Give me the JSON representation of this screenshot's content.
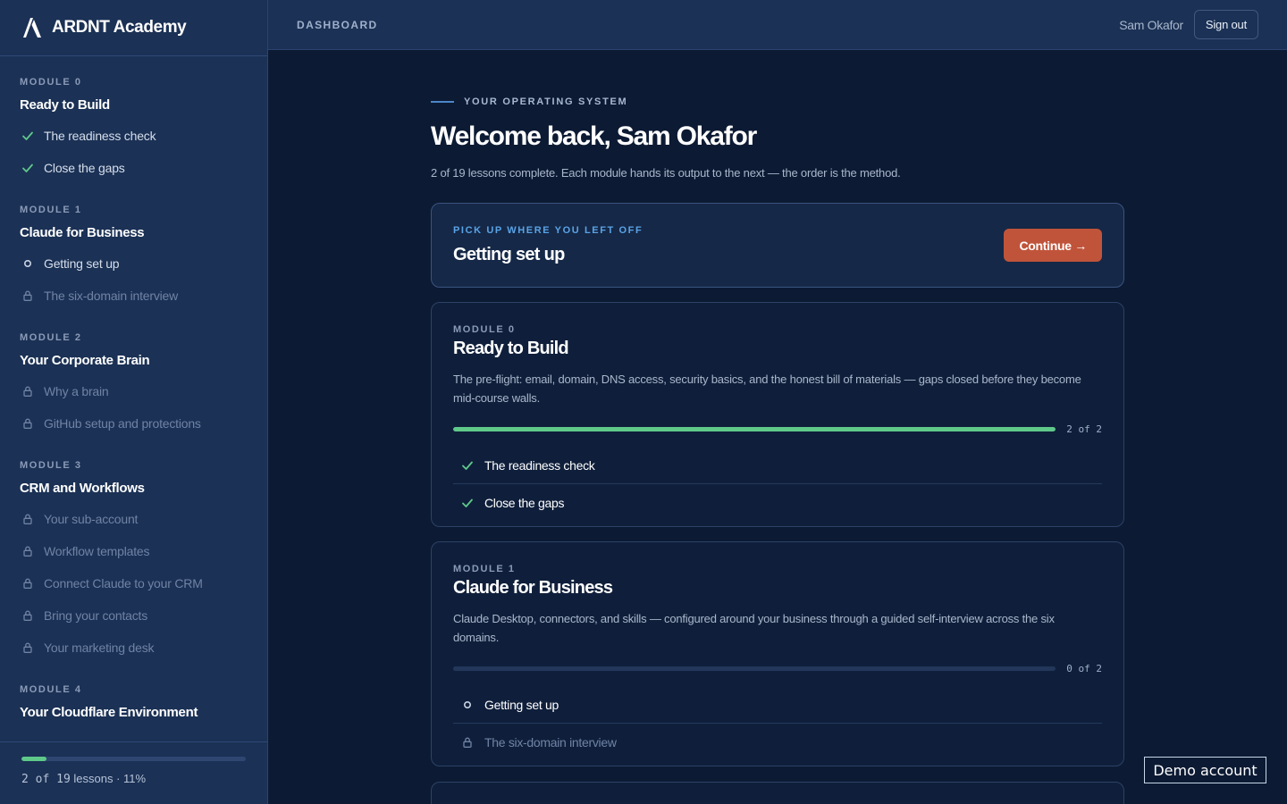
{
  "brand": {
    "name": "ARDNT Academy",
    "logo_icon": "ardnt-a-logo"
  },
  "colors": {
    "accent": "#c0543a",
    "success": "#5fc98a",
    "link": "#5aa3e6",
    "background": "#0c1a33",
    "sidebar": "#1b3155"
  },
  "sidebar": {
    "modules": [
      {
        "label": "MODULE 0",
        "title": "Ready to Build",
        "lessons": [
          {
            "title": "The readiness check",
            "status": "done",
            "icon": "check-icon"
          },
          {
            "title": "Close the gaps",
            "status": "done",
            "icon": "check-icon"
          }
        ]
      },
      {
        "label": "MODULE 1",
        "title": "Claude for Business",
        "lessons": [
          {
            "title": "Getting set up",
            "status": "current",
            "icon": "circle-icon"
          },
          {
            "title": "The six-domain interview",
            "status": "locked",
            "icon": "lock-icon"
          }
        ]
      },
      {
        "label": "MODULE 2",
        "title": "Your Corporate Brain",
        "lessons": [
          {
            "title": "Why a brain",
            "status": "locked",
            "icon": "lock-icon"
          },
          {
            "title": "GitHub setup and protections",
            "status": "locked",
            "icon": "lock-icon"
          }
        ]
      },
      {
        "label": "MODULE 3",
        "title": "CRM and Workflows",
        "lessons": [
          {
            "title": "Your sub-account",
            "status": "locked",
            "icon": "lock-icon"
          },
          {
            "title": "Workflow templates",
            "status": "locked",
            "icon": "lock-icon"
          },
          {
            "title": "Connect Claude to your CRM",
            "status": "locked",
            "icon": "lock-icon"
          },
          {
            "title": "Bring your contacts",
            "status": "locked",
            "icon": "lock-icon"
          },
          {
            "title": "Your marketing desk",
            "status": "locked",
            "icon": "lock-icon"
          }
        ]
      },
      {
        "label": "MODULE 4",
        "title": "Your Cloudflare Environment",
        "lessons": []
      }
    ],
    "footer": {
      "progress_fraction": 0.11,
      "count_text": "2 of 19",
      "suffix_text": " lessons · 11%"
    }
  },
  "topbar": {
    "breadcrumb": "DASHBOARD",
    "user_name": "Sam Okafor",
    "signout_label": "Sign out"
  },
  "main": {
    "eyebrow": "YOUR OPERATING SYSTEM",
    "welcome": "Welcome back, Sam Okafor",
    "subline": "2 of 19 lessons complete. Each module hands its output to the next — the order is the method.",
    "resume": {
      "eyebrow": "PICK UP WHERE YOU LEFT OFF",
      "title": "Getting set up",
      "button_label": "Continue →"
    },
    "modules": [
      {
        "label": "MODULE 0",
        "title": "Ready to Build",
        "description": "The pre-flight: email, domain, DNS access, security basics, and the honest bill of materials — gaps closed before they become mid-course walls.",
        "progress_fraction": 1.0,
        "count_text": "2 of 2",
        "lessons": [
          {
            "title": "The readiness check",
            "status": "done",
            "icon": "check-icon"
          },
          {
            "title": "Close the gaps",
            "status": "done",
            "icon": "check-icon"
          }
        ]
      },
      {
        "label": "MODULE 1",
        "title": "Claude for Business",
        "description": "Claude Desktop, connectors, and skills — configured around your business through a guided self-interview across the six domains.",
        "progress_fraction": 0.0,
        "count_text": "0 of 2",
        "lessons": [
          {
            "title": "Getting set up",
            "status": "current",
            "icon": "circle-icon"
          },
          {
            "title": "The six-domain interview",
            "status": "locked",
            "icon": "lock-icon"
          }
        ]
      }
    ]
  },
  "demo_badge": "Demo account"
}
